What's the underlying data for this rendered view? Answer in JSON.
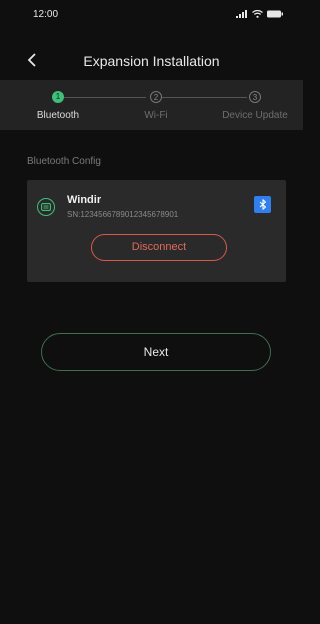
{
  "status_bar": {
    "time": "12:00"
  },
  "header": {
    "title": "Expansion Installation"
  },
  "stepper": {
    "steps": [
      {
        "number": "1",
        "label": "Bluetooth",
        "state": "active"
      },
      {
        "number": "2",
        "label": "Wi-Fi",
        "state": "inactive"
      },
      {
        "number": "3",
        "label": "Device Update",
        "state": "inactive"
      }
    ]
  },
  "section": {
    "label": "Bluetooth Config"
  },
  "device": {
    "name": "Windir",
    "serial": "SN:1234566789012345678901",
    "disconnect_label": "Disconnect"
  },
  "actions": {
    "next_label": "Next"
  },
  "colors": {
    "accent_green": "#3ec07a",
    "danger_red": "#d65a4a",
    "bluetooth_blue": "#2f7ff0",
    "background": "#0f0f0f"
  }
}
